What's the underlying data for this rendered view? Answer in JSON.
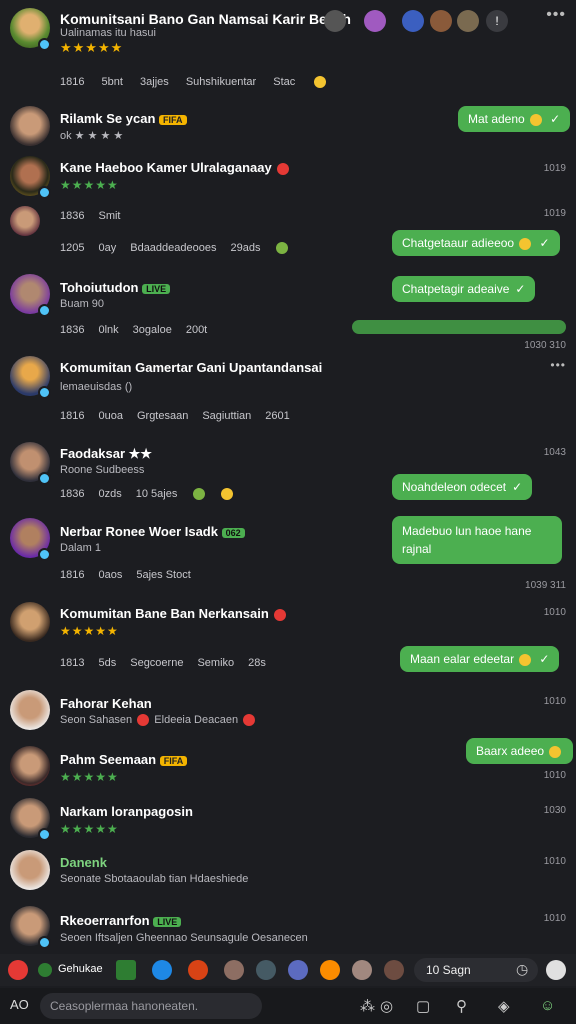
{
  "header": {
    "title": "Komunitsani Bano Gan Namsai Karir Besah",
    "subtitle": "Ualinamas itu hasui",
    "stars": "★★★★★",
    "stats": [
      "1816",
      "5bnt",
      "3ajjes",
      "Suhshikuentar",
      "Stac"
    ]
  },
  "chats": [
    {
      "name": "Rilamk Se ycan",
      "badge": "FIFA",
      "sub": "ok ★ ★ ★ ★",
      "bubble": "Mat adeno"
    },
    {
      "name": "Kane Haeboo Kamer Ulralaganaay",
      "sub": "★★★★★",
      "time": "1019"
    },
    {
      "stats": [
        "1836",
        "Smit"
      ],
      "time": "1019"
    },
    {
      "stats": [
        "1205",
        "0ay",
        "Bdaaddeadeooes",
        "29ads"
      ],
      "bubble": "Chatgetaaur adieeoo"
    },
    {
      "name": "Tohoiutudon",
      "badge": "LIVE",
      "sub": "Buam 90",
      "bubble": "Chatpetagir adeaive"
    },
    {
      "stats": [
        "1836",
        "0lnk",
        "3ogaloe",
        "200t"
      ],
      "time": "1030 310"
    },
    {
      "name": "Komumitan Gamertar Gani Upantandansai",
      "sub": "lemaeuisdas ()",
      "stats": [
        "1816",
        "0uoa",
        "Grgtesaan",
        "Sagiuttian",
        "2601"
      ]
    },
    {
      "name": "Faodaksar ★★",
      "sub": "Roone Sudbeess",
      "stats": [
        "1836",
        "0zds",
        "10 5ajes"
      ],
      "bubble": "Noahdeleon odecet",
      "time": "1043"
    },
    {
      "name": "Nerbar Ronee Woer Isadk",
      "badge": "062",
      "sub": "Dalam 1",
      "stats": [
        "1816",
        "0aos",
        "5ajes Stoct"
      ],
      "bubble": "Madebuo lun haoe hane rajnal",
      "time": "1039 311"
    },
    {
      "name": "Komumitan Bane Ban Nerkansain",
      "sub": "★★★★★",
      "stats": [
        "1813",
        "5ds",
        "Segcoerne",
        "Semiko",
        "28s"
      ],
      "bubble": "Maan ealar edeetar",
      "time": "1010"
    },
    {
      "name": "Fahorar Kehan",
      "sub": "Seon Sahasen",
      "sub2": "Eldeeia Deacaen",
      "time": "1010"
    },
    {
      "name": "Pahm Seemaan",
      "badge": "FIFA",
      "sub": "★★★★★",
      "bubble": "Baarx adeeo",
      "time": "1010"
    },
    {
      "name": "Narkam loranpagosin",
      "sub": "★★★★★",
      "time": "1030"
    },
    {
      "name": "Danenk",
      "sub": "Seonate Sbotaaoulab tian Hdaeshiede",
      "time": "1010"
    },
    {
      "name": "Rkeoerranrfon",
      "badge": "LIVE",
      "sub": "Seoen Iftsaljen Gheennao Seunsagule Oesanecen",
      "time": "1010"
    }
  ],
  "bottom": {
    "items": [
      "Gehukae"
    ],
    "search_label": "10 Sagn",
    "compose_placeholder": "Ceasoplermaa hanoneaten.",
    "app_label": "AO"
  },
  "colors": {
    "accent": "#4caf50",
    "background": "#1c1d21",
    "star": "#f4b400"
  }
}
